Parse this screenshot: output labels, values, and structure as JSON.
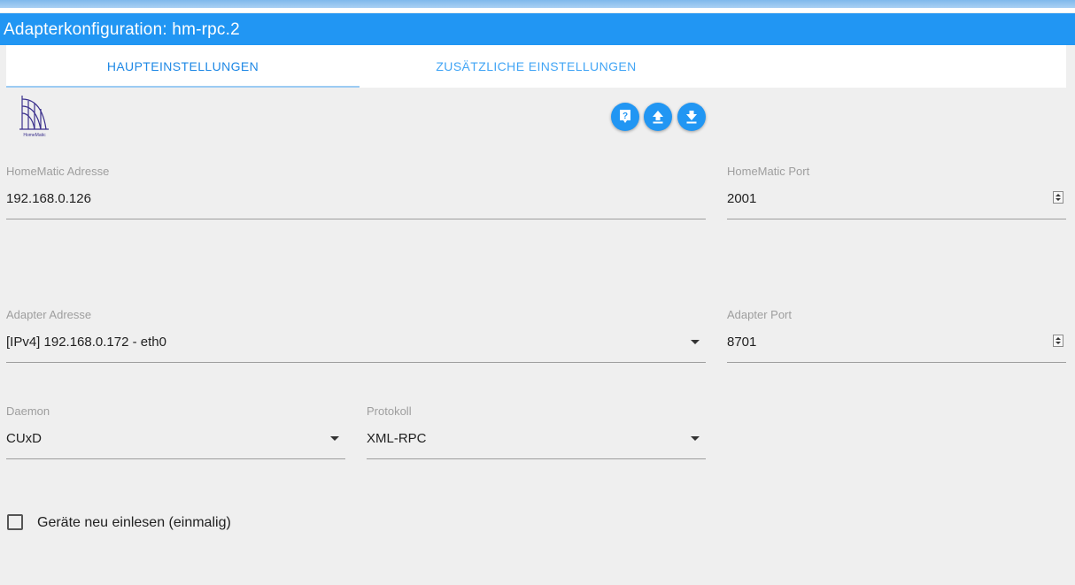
{
  "window": {
    "title": "Adapterkonfiguration: hm-rpc.2"
  },
  "tabs": [
    {
      "label": "HAUPTEINSTELLUNGEN",
      "active": true
    },
    {
      "label": "ZUSÄTZLICHE EINSTELLUNGEN",
      "active": false
    }
  ],
  "logo": {
    "text": "HomeMatic",
    "icon": "homematic-logo"
  },
  "actions": [
    {
      "icon": "help-icon"
    },
    {
      "icon": "upload-icon"
    },
    {
      "icon": "download-icon"
    }
  ],
  "fields": {
    "homematic_address": {
      "label": "HomeMatic Adresse",
      "value": "192.168.0.126"
    },
    "homematic_port": {
      "label": "HomeMatic Port",
      "value": "2001"
    },
    "adapter_address": {
      "label": "Adapter Adresse",
      "value": "[IPv4] 192.168.0.172 - eth0"
    },
    "adapter_port": {
      "label": "Adapter Port",
      "value": "8701"
    },
    "daemon": {
      "label": "Daemon",
      "value": "CUxD"
    },
    "protocol": {
      "label": "Protokoll",
      "value": "XML-RPC"
    }
  },
  "reread_devices": {
    "label": "Geräte neu einlesen (einmalig)",
    "checked": false
  },
  "colors": {
    "accent": "#2196f3",
    "background": "#efefef"
  }
}
